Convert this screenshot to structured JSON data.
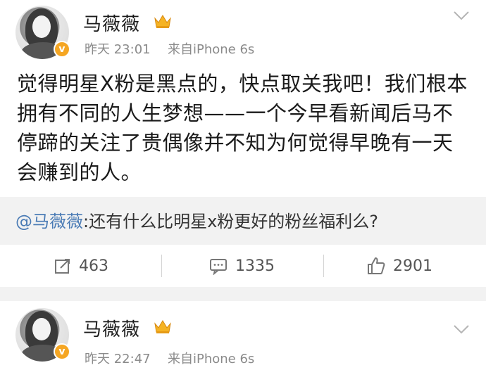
{
  "post1": {
    "author": "马薇薇",
    "time": "昨天 23:01",
    "source": "来自iPhone 6s",
    "content": "觉得明星X粉是黑点的，快点取关我吧！我们根本拥有不同的人生梦想——一个今早看新闻后马不停蹄的关注了贵偶像并不知为何觉得早晚有一天会赚到的人。",
    "quote_mention": "@马薇薇",
    "quote_text": ":还有什么比明星x粉更好的粉丝福利么?",
    "reposts": "463",
    "comments": "1335",
    "likes": "2901"
  },
  "post2": {
    "author": "马薇薇",
    "time": "昨天 22:47",
    "source": "来自iPhone 6s"
  },
  "verified_badge": "v",
  "colors": {
    "verified": "#f5a623",
    "mention": "#4a7bb5",
    "meta": "#8a8a8a"
  },
  "icons": [
    "verified-v-icon",
    "crown-icon",
    "chevron-down-icon",
    "repost-icon",
    "comment-icon",
    "like-icon"
  ]
}
